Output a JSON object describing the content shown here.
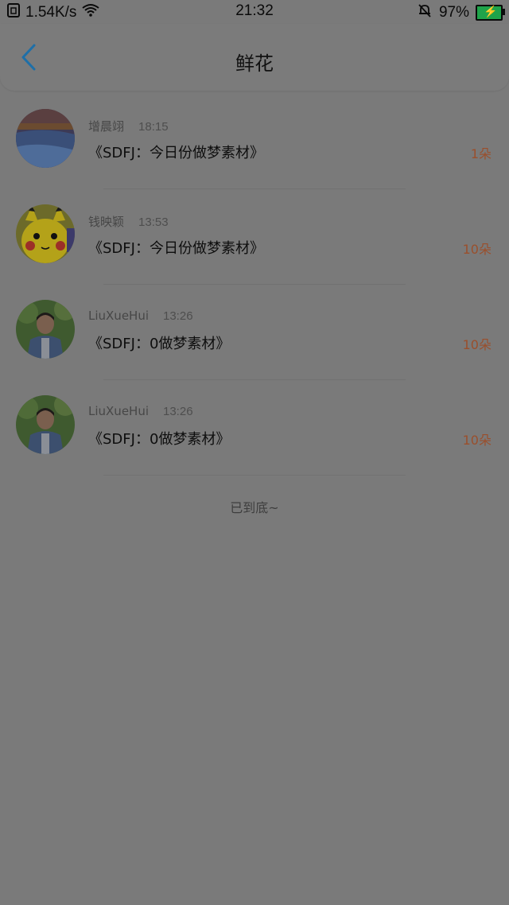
{
  "status_bar": {
    "speed": "1.54K/s",
    "time": "21:32",
    "battery": "97%",
    "icons": [
      "sim-icon",
      "wifi-icon",
      "mute-bell-icon",
      "battery-charging-icon"
    ]
  },
  "header": {
    "title": "鲜花",
    "back_icon": "chevron-left-icon",
    "accent": "#1e6fa8"
  },
  "rows": [
    {
      "name": "增晨翊",
      "time": "18:15",
      "message": "《SDFJ：今日份做梦素材》",
      "count": "1朵",
      "avatar": "landscape"
    },
    {
      "name": "钱映颖",
      "time": "13:53",
      "message": "《SDFJ：今日份做梦素材》",
      "count": "10朵",
      "avatar": "pikachu"
    },
    {
      "name": "LiuXueHui",
      "time": "13:26",
      "message": "《SDFJ：0做梦素材》",
      "count": "10朵",
      "avatar": "person"
    },
    {
      "name": "LiuXueHui",
      "time": "13:26",
      "message": "《SDFJ：0做梦素材》",
      "count": "10朵",
      "avatar": "person"
    }
  ],
  "footer": {
    "end_text": "已到底~"
  },
  "colors": {
    "overlay_bg": "#7a7a7a",
    "count_color": "#9a4f2c",
    "battery_fill": "#1fa34a"
  }
}
